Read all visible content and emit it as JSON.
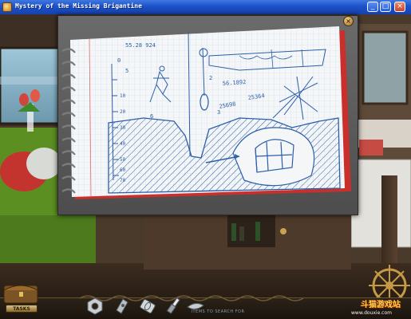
{
  "window": {
    "title": "Mystery of the Missing Brigantine",
    "buttons": {
      "minimize": "_",
      "maximize": "□",
      "close": "×"
    }
  },
  "notebook": {
    "close_glyph": "×",
    "numbers": {
      "top_left": "55.28  924",
      "zero": "0",
      "five": "5",
      "two": "2",
      "six": "6",
      "coord_a": "56.1892",
      "coord_b": "25698",
      "coord_c": "25364",
      "three": "3"
    },
    "scale_ticks": [
      "10",
      "20",
      "30",
      "40",
      "50",
      "60",
      "70"
    ]
  },
  "hud": {
    "tasks_label": "TASKS",
    "hint_label": "ITEMS TO SEARCH FOR",
    "inventory": [
      {
        "name": "hex-nut-icon"
      },
      {
        "name": "bracket-icon"
      },
      {
        "name": "pipe-fitting-icon"
      },
      {
        "name": "spark-plug-icon"
      },
      {
        "name": "clip-icon"
      }
    ]
  },
  "watermark": {
    "logo": "斗猫游戏站",
    "url": "www.douxie.com"
  },
  "colors": {
    "titlebar": "#1c51c8",
    "ink": "#2c5fa8",
    "paper": "#f4f6f8",
    "cabin_green": "#5c8f22",
    "pillow_red": "#c4342e"
  }
}
